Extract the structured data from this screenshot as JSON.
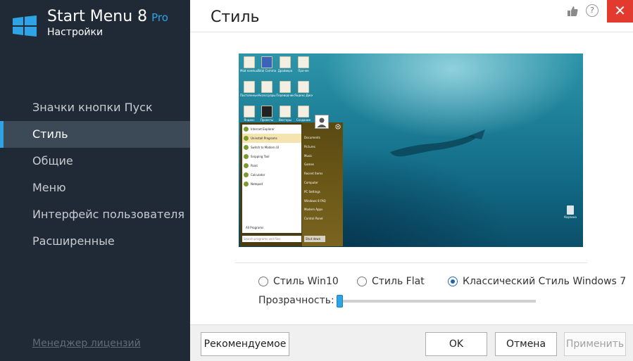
{
  "app": {
    "title": "Start Menu 8",
    "edition": "Pro",
    "subtitle": "Настройки"
  },
  "sidebar": {
    "items": [
      {
        "label": "Значки кнопки Пуск",
        "active": false
      },
      {
        "label": "Стиль",
        "active": true
      },
      {
        "label": "Общие",
        "active": false
      },
      {
        "label": "Меню",
        "active": false
      },
      {
        "label": "Интерфейс пользователя",
        "active": false
      },
      {
        "label": "Расширенные",
        "active": false
      }
    ],
    "license_link": "Менеджер лицензий"
  },
  "header": {
    "page_title": "Стиль",
    "help_icon": "?",
    "close_icon": "✕"
  },
  "preview": {
    "desktop_icons": [
      "Мой компьютер",
      "Total Commander",
      "Драйвера",
      "Прочее",
      "Постоянные программы",
      "Аксессуары",
      "Переводчик",
      "Яндекс.Диск",
      "Яндекс",
      "Проекты",
      "Векторы",
      "Создание"
    ],
    "start_left": [
      "Internet Explorer",
      "Uninstall Programs",
      "Switch to Modern UI",
      "Snipping Tool",
      "Paint",
      "Calculator",
      "Notepad"
    ],
    "start_right": [
      "Documents",
      "Pictures",
      "Music",
      "Games",
      "Recent Items",
      "Computer",
      "PC Settings",
      "Windows 8 FAQ",
      "Modern Apps",
      "Control Panel"
    ],
    "all_programs": "All Programs",
    "search_placeholder": "Search programs and files",
    "shutdown": "Shut down",
    "recycle_bin": "Корзина"
  },
  "style_options": [
    {
      "label": "Стиль Win10",
      "checked": false
    },
    {
      "label": "Стиль Flat",
      "checked": false
    },
    {
      "label": "Классический Стиль Windows 7",
      "checked": true
    }
  ],
  "transparency": {
    "label": "Прозрачность:",
    "value_percent": 0
  },
  "footer": {
    "recommended_label": "Рекомендуемое",
    "ok_label": "OK",
    "cancel_label": "Отмена",
    "apply_label": "Применить"
  },
  "colors": {
    "sidebar_bg": "#1f2a36",
    "active_item_bg": "#3c4957",
    "accent": "#2ea4e6",
    "close_red": "#e33a30"
  },
  "icons": {
    "logo": "windows-logo-icon",
    "like": "thumbs-up-icon",
    "help": "help-icon",
    "close": "close-icon",
    "user": "user-avatar-icon",
    "gear": "gear-icon",
    "recycle": "recycle-bin-icon"
  }
}
